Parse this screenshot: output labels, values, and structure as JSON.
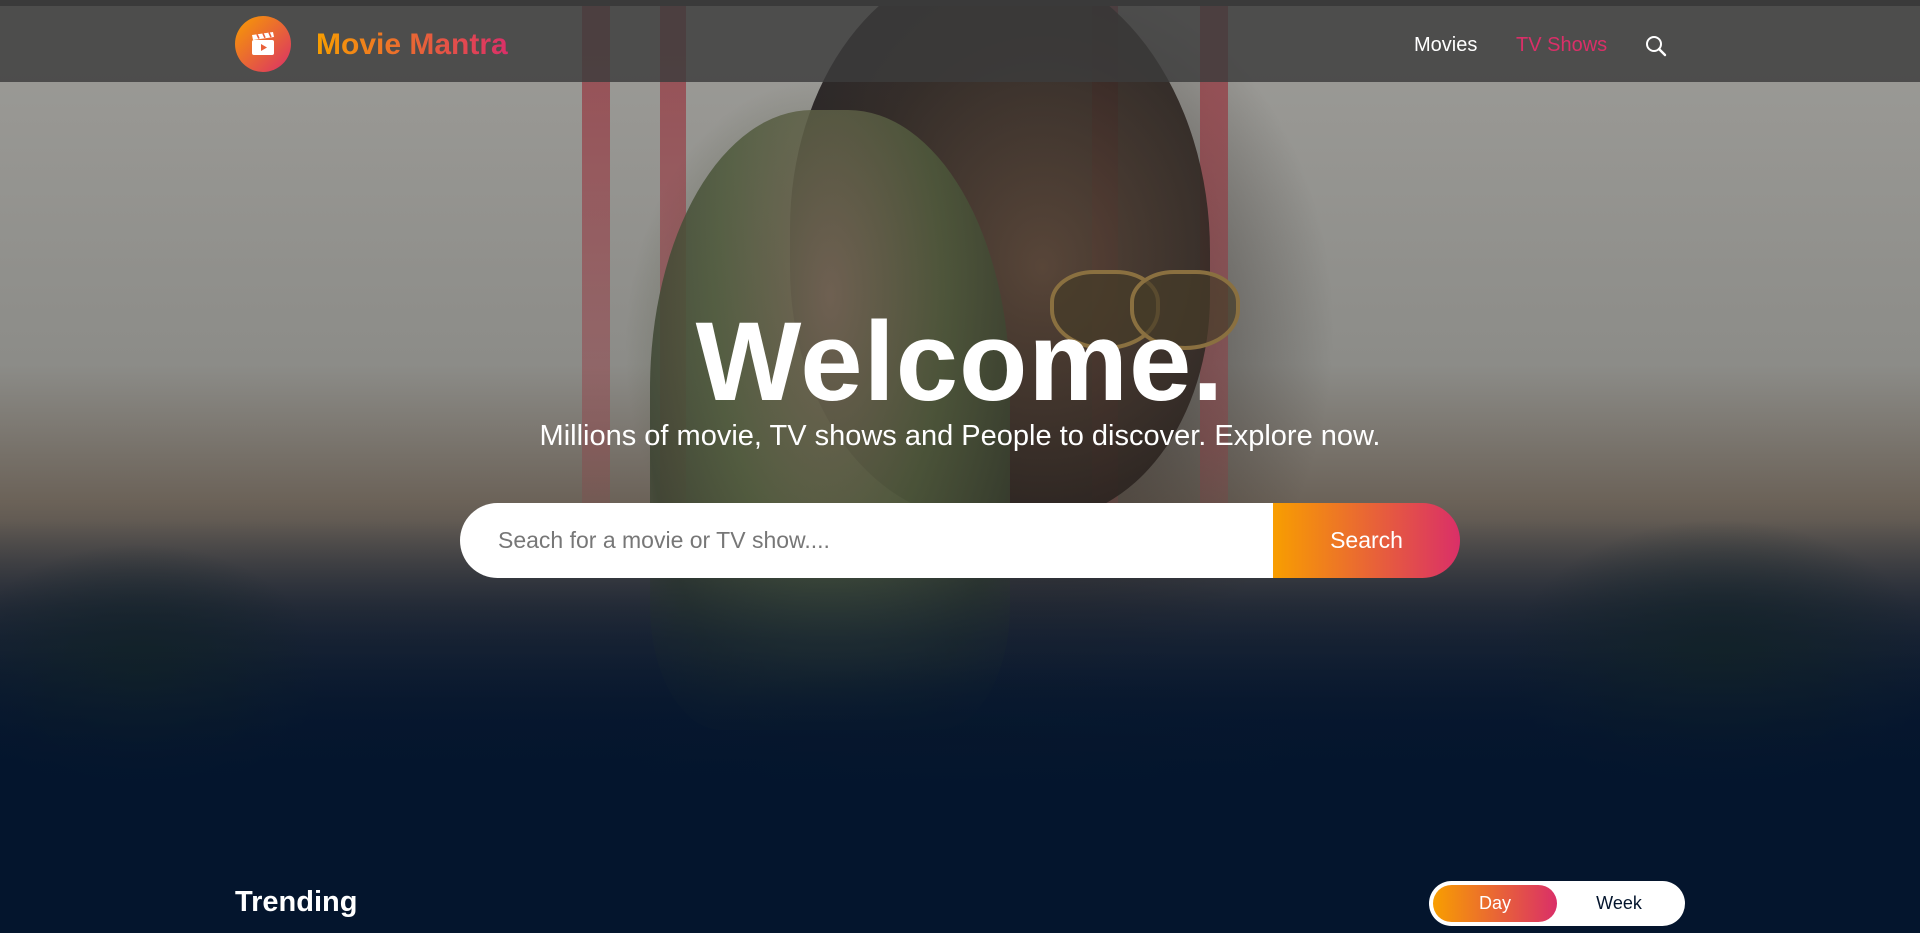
{
  "header": {
    "logo_text": "Movie Mantra",
    "nav": {
      "movies_label": "Movies",
      "tv_shows_label": "TV Shows"
    }
  },
  "hero": {
    "title": "Welcome.",
    "subtitle": "Millions of movie, TV shows and People to discover. Explore now.",
    "search": {
      "placeholder": "Seach for a movie or TV show....",
      "value": "",
      "button_label": "Search"
    }
  },
  "trending": {
    "title": "Trending",
    "tabs": [
      {
        "label": "Day",
        "active": true
      },
      {
        "label": "Week",
        "active": false
      }
    ]
  },
  "colors": {
    "background": "#04152d",
    "accent_start": "#f89e00",
    "accent_end": "#da2f68",
    "header_bg": "#3c3c3c"
  },
  "icons": {
    "logo": "film-clapper-icon",
    "search": "search-icon"
  }
}
